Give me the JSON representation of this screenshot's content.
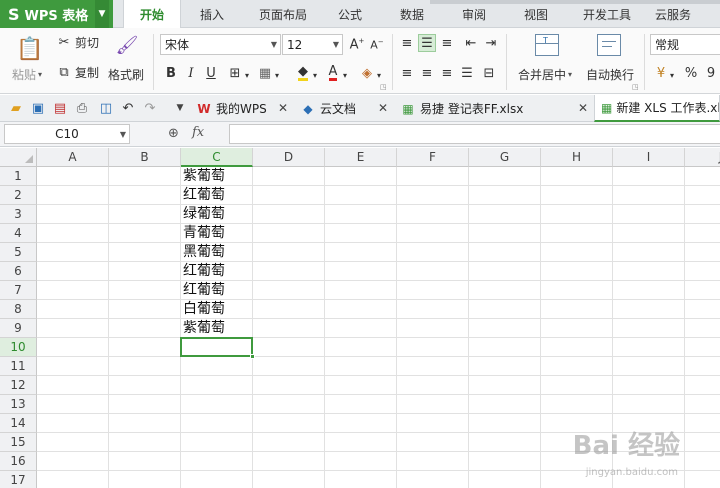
{
  "app": {
    "name": "WPS 表格",
    "logo": "S"
  },
  "menu": {
    "tabs": [
      {
        "label": "开始",
        "active": true
      },
      {
        "label": "插入",
        "active": false
      },
      {
        "label": "页面布局",
        "active": false
      },
      {
        "label": "公式",
        "active": false
      },
      {
        "label": "数据",
        "active": false
      },
      {
        "label": "审阅",
        "active": false
      },
      {
        "label": "视图",
        "active": false
      },
      {
        "label": "开发工具",
        "active": false
      },
      {
        "label": "云服务",
        "active": false
      }
    ]
  },
  "ribbon": {
    "paste_label": "粘贴",
    "cut_label": "剪切",
    "copy_label": "复制",
    "format_painter_label": "格式刷",
    "font_name": "宋体",
    "font_size": "12",
    "bold": "B",
    "italic": "I",
    "underline": "U",
    "merge_label": "合并居中",
    "wrap_label": "自动换行",
    "number_format": "常规",
    "percent": "%",
    "comma": "9"
  },
  "doc_tabs": [
    {
      "label": "我的WPS",
      "icon": "wps-logo-icon",
      "active": false
    },
    {
      "label": "云文档",
      "icon": "cloud-doc-icon",
      "active": false
    },
    {
      "label": "易捷 登记表FF.xlsx",
      "icon": "sheet-file-icon",
      "active": false
    },
    {
      "label": "新建 XLS 工作表.xlsx",
      "icon": "sheet-file-icon",
      "active": true
    }
  ],
  "formula_bar": {
    "cell_ref": "C10",
    "fx": "fx",
    "formula": ""
  },
  "columns": [
    "A",
    "B",
    "C",
    "D",
    "E",
    "F",
    "G",
    "H",
    "I",
    "J"
  ],
  "rows": [
    "1",
    "2",
    "3",
    "4",
    "5",
    "6",
    "7",
    "8",
    "9",
    "10",
    "11",
    "12",
    "13",
    "14",
    "15",
    "16",
    "17"
  ],
  "cells": {
    "C1": "紫葡萄",
    "C2": "红葡萄",
    "C3": "绿葡萄",
    "C4": "青葡萄",
    "C5": "黑葡萄",
    "C6": "红葡萄",
    "C7": "红葡萄",
    "C8": "白葡萄",
    "C9": "紫葡萄"
  },
  "selection": {
    "column": "C",
    "row": "10"
  },
  "watermark": {
    "brand": "Bai 经验",
    "url": "jingyan.baidu.com"
  },
  "colors": {
    "accent": "#3f9a3e",
    "menu_bg": "#e4e7ea"
  }
}
